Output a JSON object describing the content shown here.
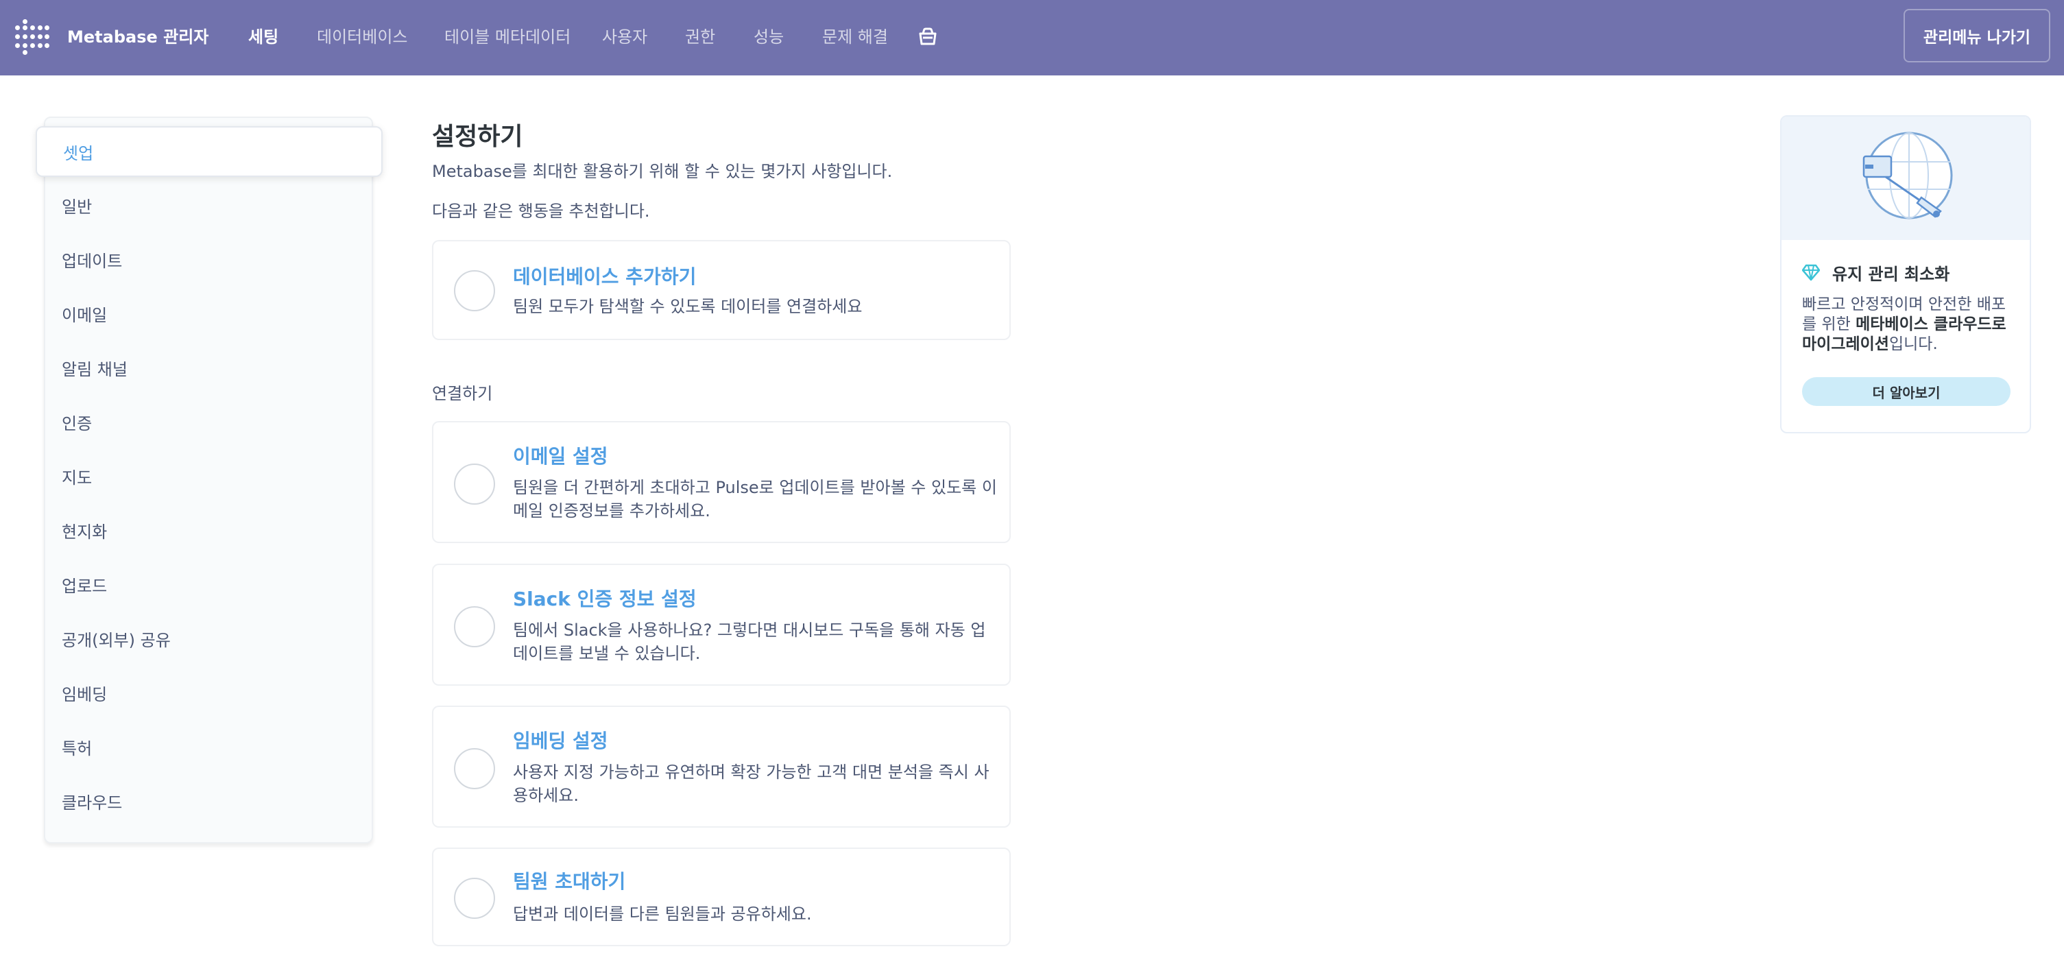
{
  "nav": {
    "brand": "Metabase 관리자",
    "items": [
      "세팅",
      "데이터베이스",
      "테이블 메타데이터",
      "사용자",
      "권한",
      "성능",
      "문제 해결"
    ],
    "active_index": 0,
    "exit_label": "관리메뉴 나가기"
  },
  "sidebar": {
    "items": [
      "셋업",
      "일반",
      "업데이트",
      "이메일",
      "알림 채널",
      "인증",
      "지도",
      "현지화",
      "업로드",
      "공개(외부) 공유",
      "임베딩",
      "특허",
      "클라우드"
    ],
    "active_index": 0
  },
  "main": {
    "title": "설정하기",
    "description": "Metabase를 최대한 활용하기 위해 할 수 있는 몇가지 사항입니다.",
    "recommend_label": "다음과 같은 행동을 추천합니다.",
    "recommend_cards": [
      {
        "title": "데이터베이스 추가하기",
        "text": "팀원 모두가 탐색할 수 있도록 데이터를 연결하세요"
      }
    ],
    "connect_label": "연결하기",
    "connect_cards": [
      {
        "title": "이메일 설정",
        "text": "팀원을 더 간편하게 초대하고 Pulse로 업데이트를 받아볼 수 있도록 이메일 인증정보를 추가하세요."
      },
      {
        "title": "Slack 인증 정보 설정",
        "text": "팀에서 Slack을 사용하나요? 그렇다면 대시보드 구독을 통해 자동 업데이트를 보낼 수 있습니다."
      },
      {
        "title": "임베딩 설정",
        "text": "사용자 지정 가능하고 유연하며 확장 가능한 고객 대면 분석을 즉시 사용하세요."
      },
      {
        "title": "팀원 초대하기",
        "text": "답변과 데이터를 다른 팀원들과 공유하세요."
      }
    ]
  },
  "promo": {
    "title": "유지 관리 최소화",
    "text_before": "빠르고 안정적이며 안전한 배포를 위한 ",
    "text_bold": "메타베이스 클라우드로 마이그레이션",
    "text_after": "입니다.",
    "button_label": "더 알아보기"
  },
  "colors": {
    "nav_bg": "#7172ad",
    "accent_blue": "#509ee3",
    "promo_button": "#cdecf9",
    "gem": "#3bc3d6"
  },
  "icons": [
    "metabase-logo-icon",
    "shopping-bag-icon",
    "diamond-gem-icon",
    "globe-rocket-illustration"
  ]
}
